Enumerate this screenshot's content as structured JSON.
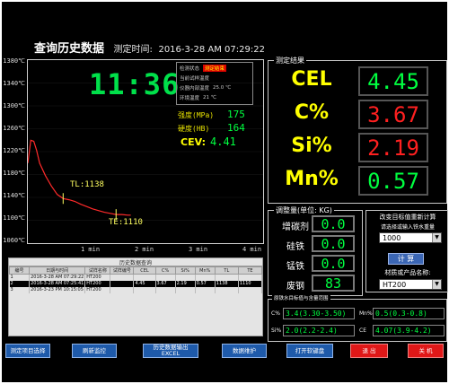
{
  "header": {
    "title": "查询历史数据",
    "time_label": "测定时间:",
    "time_value": "2016-3-28 AM 07:29:22"
  },
  "chart": {
    "clock": "11:36",
    "y_ticks": [
      "1380℃",
      "1340℃",
      "1300℃",
      "1260℃",
      "1220℃",
      "1180℃",
      "1140℃",
      "1100℃",
      "1060℃"
    ],
    "x_ticks": [
      "1 min",
      "2 min",
      "3 min",
      "4 min"
    ],
    "tl_label": "TL:1138",
    "te_label": "TE:1110",
    "info_rows": [
      {
        "label": "检测状态",
        "value": "测定结束",
        "highlight": true
      },
      {
        "label": "当前试样温度",
        "value": "",
        "highlight": false
      },
      {
        "label": "仪器内部温度",
        "value": "25.0 ℃",
        "highlight": false
      },
      {
        "label": "环境温度",
        "value": "21 ℃",
        "highlight": false
      }
    ],
    "measures": [
      {
        "label": "强度(MPa)",
        "value": "175"
      },
      {
        "label": "硬度(HB)",
        "value": "164"
      }
    ],
    "cev_label": "CEV:",
    "cev_value": "4.41"
  },
  "chart_data": {
    "type": "line",
    "xlabel": "",
    "ylabel": "",
    "ylim": [
      1060,
      1380
    ],
    "xlim_min": [
      0,
      4
    ],
    "x": [
      0.0,
      0.05,
      0.1,
      0.15,
      0.2,
      0.3,
      0.4,
      0.5,
      0.6,
      0.7,
      0.8,
      0.9,
      1.0,
      1.1,
      1.2,
      1.3,
      1.4,
      1.5,
      1.6,
      1.7,
      1.75
    ],
    "series": [
      {
        "values": [
          1200,
          1240,
          1238,
          1222,
          1200,
          1178,
          1160,
          1145,
          1138,
          1136,
          1133,
          1128,
          1124,
          1120,
          1117,
          1114,
          1112,
          1110,
          1110,
          1109,
          1109
        ]
      }
    ],
    "annotations": [
      "TL:1138",
      "TE:1110"
    ]
  },
  "table": {
    "caption": "历史数据查询",
    "columns": [
      "编号",
      "日期与时间",
      "试样名称",
      "试样编号",
      "CEL",
      "C%",
      "Si%",
      "Mn%",
      "TL",
      "TE"
    ],
    "rows": [
      {
        "no": "1",
        "datetime": "2016-3-28 AM 07:29:22",
        "name": "HT200",
        "code": "",
        "cel": "",
        "c": "",
        "si": "",
        "mn": "",
        "tl": "",
        "te": ""
      },
      {
        "no": "2",
        "datetime": "2016-3-28 AM 07:25:41",
        "name": "HT200",
        "code": "",
        "cel": "4.45",
        "c": "3.67",
        "si": "2.19",
        "mn": "0.57",
        "tl": "1138",
        "te": "1110"
      },
      {
        "no": "3",
        "datetime": "2016-3-23 PM 10:15:05",
        "name": "HT200",
        "code": "",
        "cel": "",
        "c": "",
        "si": "",
        "mn": "",
        "tl": "",
        "te": ""
      }
    ]
  },
  "results": {
    "title": "测定结果",
    "items": [
      {
        "label": "CEL",
        "value": "4.45",
        "color": "#00ff40"
      },
      {
        "label": "C%",
        "value": "3.67",
        "color": "#ff2020"
      },
      {
        "label": "Si%",
        "value": "2.19",
        "color": "#ff2020"
      },
      {
        "label": "Mn%",
        "value": "0.57",
        "color": "#00ff40"
      }
    ]
  },
  "adjust": {
    "title": "调整量(单位: KG)",
    "items": [
      {
        "label": "增碳剂",
        "value": "0.0"
      },
      {
        "label": "硅铁",
        "value": "0.0"
      },
      {
        "label": "锰铁",
        "value": "0.0"
      },
      {
        "label": "废钢",
        "value": "83"
      }
    ]
  },
  "target": {
    "title": "改变目标值重新计算",
    "hint": "请选择或输入铁水重量",
    "weight": "1000",
    "calc_label": "计 算",
    "material_label": "材质或产品名称:",
    "material": "HT200"
  },
  "calibration": {
    "title": "原铁水目标值与含量范围",
    "rows": [
      {
        "label": "C%",
        "value": "3.4(3.30-3.50)"
      },
      {
        "label": "Mn%",
        "value": "0.5(0.3-0.8)"
      },
      {
        "label": "Si%",
        "value": "2.0(2.2-2.4)"
      },
      {
        "label": "CE",
        "value": "4.07(3.9-4.2)"
      }
    ]
  },
  "buttons": [
    {
      "name": "项目选择",
      "label": "测定项目选择",
      "red": false
    },
    {
      "name": "realtime",
      "label": "刷新监控",
      "red": false
    },
    {
      "name": "export",
      "label": "历史数据输出\nEXCEL",
      "red": false
    },
    {
      "name": "maintain",
      "label": "数据维护",
      "red": false
    },
    {
      "name": "keyboard",
      "label": "打开软键盘",
      "red": false
    },
    {
      "name": "exit",
      "label": "退 出",
      "red": true
    },
    {
      "name": "shutdown",
      "label": "关 机",
      "red": true
    }
  ]
}
